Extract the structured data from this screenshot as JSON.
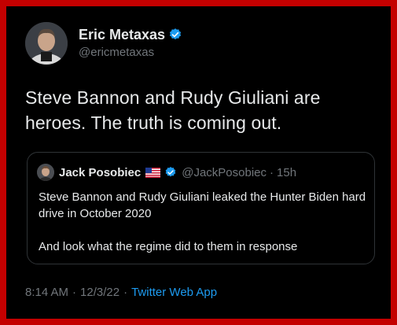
{
  "tweet": {
    "author": {
      "display_name": "Eric Metaxas",
      "handle": "@ericmetaxas",
      "verified_icon": "verified-badge-icon"
    },
    "text": "Steve Bannon and Rudy Giuliani are heroes. The truth is coming out.",
    "quoted_tweet": {
      "author": {
        "display_name": "Jack Posobiec",
        "flag_icon": "us-flag-icon",
        "verified_icon": "verified-badge-icon",
        "handle": "@JackPosobiec"
      },
      "separator": "·",
      "time": "15h",
      "line1": "Steve Bannon and Rudy Giuliani leaked the Hunter Biden hard drive in October 2020",
      "line2": "And look what the regime did to them in response"
    },
    "meta": {
      "time": "8:14 AM",
      "separator1": "·",
      "date": "12/3/22",
      "separator2": "·",
      "app": "Twitter Web App"
    }
  },
  "colors": {
    "background": "#000000",
    "frame": "#c40000",
    "text_primary": "#e7e9ea",
    "text_secondary": "#71767b",
    "accent": "#1d9bf0",
    "border": "#2f3336"
  }
}
